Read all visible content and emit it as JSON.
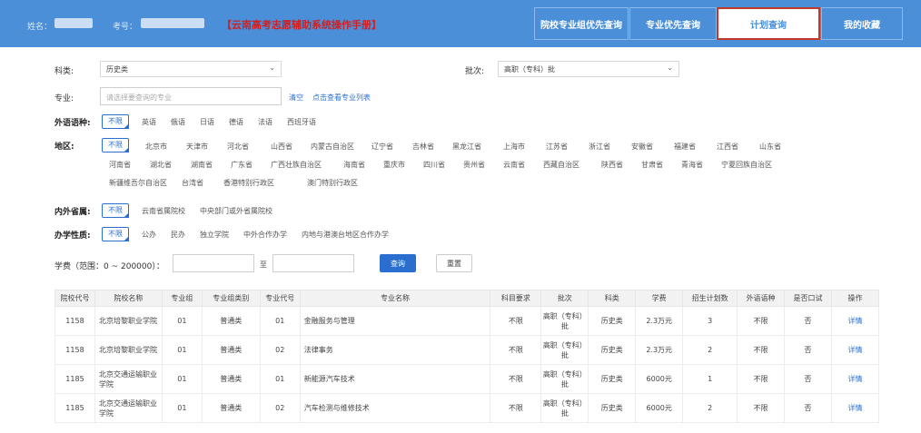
{
  "header": {
    "name_label": "姓名：",
    "exam_label": "考号：",
    "manual": "【云南高考志愿辅助系统操作手册】",
    "tabs": [
      {
        "label": "院校专业组优先查询"
      },
      {
        "label": "专业优先查询"
      },
      {
        "label": "计划查询"
      },
      {
        "label": "我的收藏"
      }
    ]
  },
  "filters": {
    "subject_label": "科类:",
    "subject_value": "历史类",
    "batch_label": "批次:",
    "batch_value": "高职（专科）批",
    "major_label": "专业:",
    "major_placeholder": "请选择要查询的专业",
    "clear_link": "清空",
    "view_list_link": "点击查看专业列表",
    "language_label": "外语语种:",
    "none_label": "不限",
    "languages": [
      "英语",
      "俄语",
      "日语",
      "德语",
      "法语",
      "西班牙语"
    ],
    "region_label": "地区:",
    "regions_row1": [
      "北京市",
      "天津市",
      "河北省",
      "山西省",
      "内蒙古自治区",
      "辽宁省",
      "吉林省",
      "黑龙江省",
      "上海市",
      "江苏省",
      "浙江省",
      "安徽省",
      "福建省",
      "江西省",
      "山东省"
    ],
    "regions_row2": [
      "河南省",
      "湖北省",
      "湖南省",
      "广东省",
      "广西壮族自治区",
      "海南省",
      "重庆市",
      "四川省",
      "贵州省",
      "云南省",
      "西藏自治区",
      "陕西省",
      "甘肃省",
      "青海省",
      "宁夏回族自治区"
    ],
    "regions_row3": [
      "新疆维吾尔自治区",
      "台湾省",
      "香港特别行政区",
      "澳门特别行政区"
    ],
    "inout_label": "内外省属:",
    "inout_options": [
      "云南省属院校",
      "中央部门或外省属院校"
    ],
    "nature_label": "办学性质:",
    "nature_options": [
      "公办",
      "民办",
      "独立学院",
      "中外合作办学",
      "内地与港澳台地区合作办学"
    ],
    "tuition_label": "学费（范围：0 ~ 200000）：",
    "tuition_to": "至",
    "query_button": "查询",
    "reset_button": "重置"
  },
  "table": {
    "headers": [
      "院校代号",
      "院校名称",
      "专业组",
      "专业组类别",
      "专业代号",
      "专业名称",
      "科目要求",
      "批次",
      "科类",
      "学费",
      "招生计划数",
      "外语语种",
      "是否口试",
      "操作"
    ],
    "rows": [
      [
        "1158",
        "北京培黎职业学院",
        "01",
        "普通类",
        "01",
        "金融服务与管理",
        "不限",
        "高职（专科）批",
        "历史类",
        "2.3万元",
        "3",
        "不限",
        "否",
        "详情"
      ],
      [
        "1158",
        "北京培黎职业学院",
        "01",
        "普通类",
        "02",
        "法律事务",
        "不限",
        "高职（专科）批",
        "历史类",
        "2.3万元",
        "2",
        "不限",
        "否",
        "详情"
      ],
      [
        "1185",
        "北京交通运输职业学院",
        "01",
        "普通类",
        "01",
        "新能源汽车技术",
        "不限",
        "高职（专科）批",
        "历史类",
        "6000元",
        "1",
        "不限",
        "否",
        "详情"
      ],
      [
        "1185",
        "北京交通运输职业学院",
        "01",
        "普通类",
        "02",
        "汽车检测与维修技术",
        "不限",
        "高职（专科）批",
        "历史类",
        "6000元",
        "2",
        "不限",
        "否",
        "详情"
      ]
    ]
  },
  "colors": {
    "header_bg": "#4a8fd8",
    "accent": "#2a6fcf",
    "manual_red": "#d21f1f",
    "active_tab_border": "#c0392b"
  }
}
